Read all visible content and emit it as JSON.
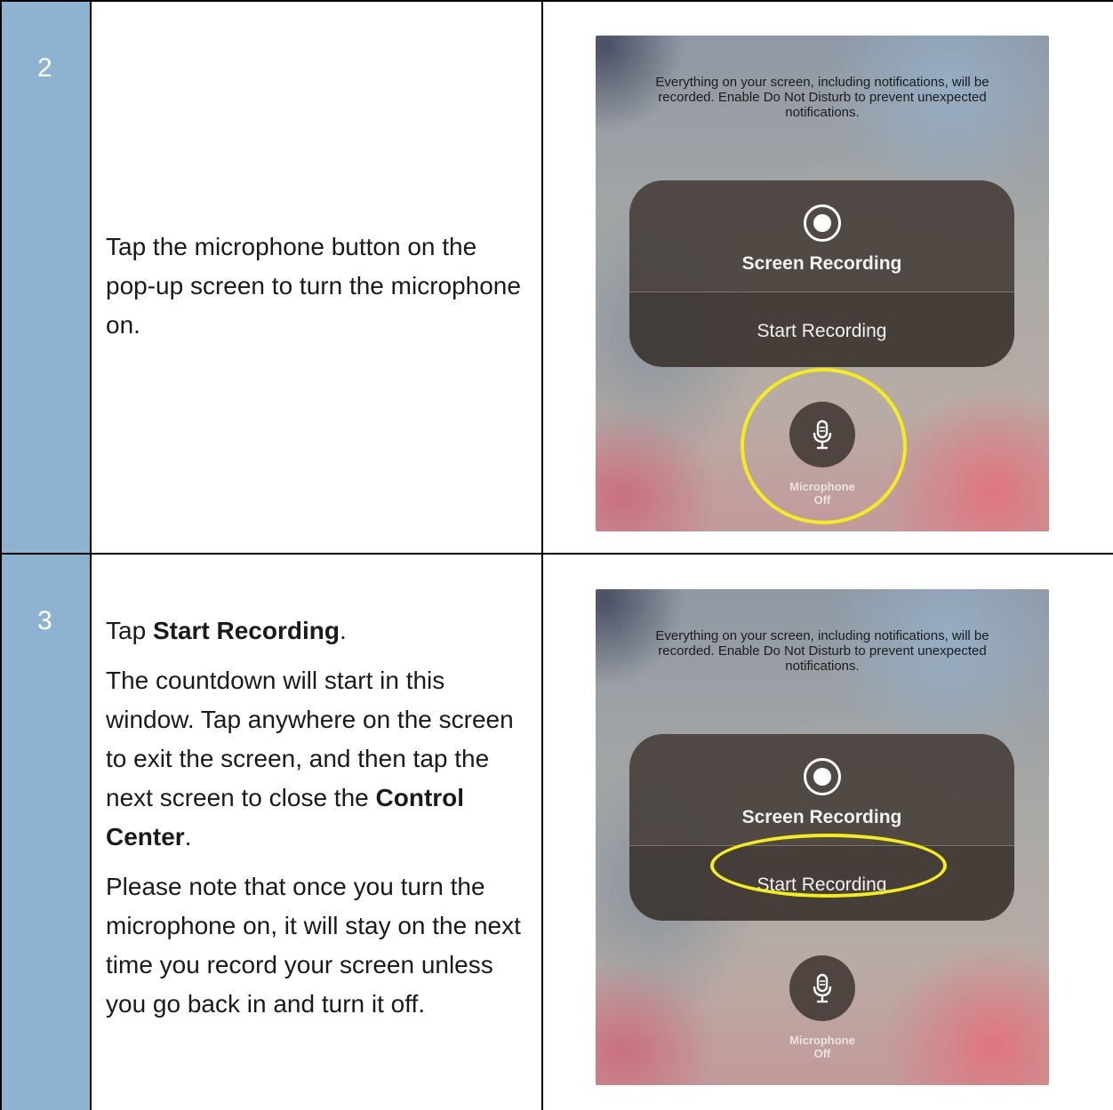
{
  "steps": [
    {
      "number": "2",
      "paragraphs": [
        [
          {
            "text": "Tap the microphone button on the pop-up screen to turn the microphone on."
          }
        ]
      ],
      "screenshot": {
        "notice": "Everything on your screen, including notifications, will be recorded. Enable Do Not Disturb to prevent unexpected notifications.",
        "title": "Screen Recording",
        "action": "Start Recording",
        "mic_label": "Microphone",
        "mic_state": "Off",
        "highlight_target": "microphone"
      }
    },
    {
      "number": "3",
      "paragraphs": [
        [
          {
            "text": "Tap "
          },
          {
            "text": "Start Recording",
            "bold": true
          },
          {
            "text": "."
          }
        ],
        [
          {
            "text": "The countdown will start in this window. Tap anywhere on the screen to exit the screen, and then tap the next screen to close the "
          },
          {
            "text": "Control Center",
            "bold": true
          },
          {
            "text": "."
          }
        ],
        [
          {
            "text": "Please note that once you turn the microphone on, it will stay on the next time you record your screen unless you go back in and turn it off."
          }
        ]
      ],
      "screenshot": {
        "notice": "Everything on your screen, including notifications, will be recorded. Enable Do Not Disturb to prevent unexpected notifications.",
        "title": "Screen Recording",
        "action": "Start Recording",
        "mic_label": "Microphone",
        "mic_state": "Off",
        "highlight_target": "start-recording"
      }
    }
  ],
  "colors": {
    "number_column": "#8db3d1",
    "highlight": "#f5ec1c",
    "panel": "#463e3a"
  },
  "icons": {
    "record": "record-icon",
    "microphone": "microphone-icon"
  }
}
